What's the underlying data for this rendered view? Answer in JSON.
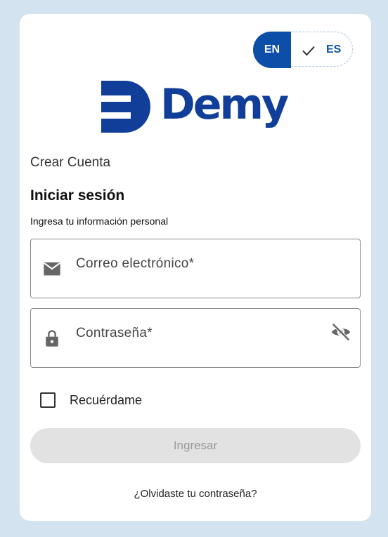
{
  "language": {
    "en_label": "EN",
    "es_label": "ES",
    "selected": "ES"
  },
  "brand": {
    "name": "Demy",
    "color": "#103e99",
    "accent": "#0d4fa8"
  },
  "links": {
    "create_account": "Crear Cuenta",
    "forgot_password": "¿Olvidaste tu contraseña?"
  },
  "login": {
    "title": "Iniciar sesión",
    "subtitle": "Ingresa tu información personal",
    "email_label": "Correo electrónico*",
    "password_label": "Contraseña*",
    "remember_label": "Recuérdame",
    "remember_checked": false,
    "submit_label": "Ingresar"
  },
  "icons": [
    "mail-icon",
    "lock-icon",
    "eye-off-icon",
    "check-icon"
  ]
}
